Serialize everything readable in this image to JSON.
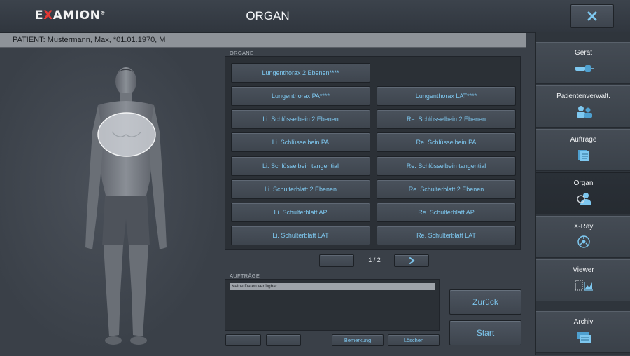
{
  "header": {
    "logo_prefix": "E",
    "logo_x": "X",
    "logo_rest": "AMION",
    "logo_mark": "®",
    "title": "ORGAN"
  },
  "patient": {
    "label": "PATIENT: Mustermann, Max, *01.01.1970, M"
  },
  "sidebar": {
    "items": [
      {
        "label": "Gerät",
        "icon": "device-icon"
      },
      {
        "label": "Patientenverwalt.",
        "icon": "patients-icon"
      },
      {
        "label": "Aufträge",
        "icon": "orders-icon"
      },
      {
        "label": "Organ",
        "icon": "organ-icon",
        "active": true
      },
      {
        "label": "X-Ray",
        "icon": "xray-icon"
      },
      {
        "label": "Viewer",
        "icon": "viewer-icon"
      },
      {
        "label": "Archiv",
        "icon": "archive-icon"
      }
    ]
  },
  "organs": {
    "section_label": "ORGANE",
    "buttons": [
      "Lungenthorax 2 Ebenen****",
      "Lungenthorax PA****",
      "Lungenthorax LAT****",
      "Li. Schlüsselbein 2 Ebenen",
      "Re. Schlüsselbein 2 Ebenen",
      "Li. Schlüsselbein PA",
      "Re. Schlüsselbein PA",
      "Li. Schlüsselbein tangential",
      "Re. Schlüsselbein tangential",
      "Li. Schulterblatt 2 Ebenen",
      "Re. Schulterblatt 2 Ebenen",
      "Li. Schulterblatt AP",
      "Re. Schulterblatt AP",
      "Li. Schulterblatt LAT",
      "Re. Schulterblatt LAT"
    ],
    "page_indicator": "1 / 2"
  },
  "orders": {
    "section_label": "AUFTRÄGE",
    "empty_text": "Keine Daten verfügbar",
    "remark_label": "Bemerkung",
    "delete_label": "Löschen"
  },
  "actions": {
    "back_label": "Zurück",
    "start_label": "Start"
  },
  "colors": {
    "accent_text": "#7ec8f0",
    "logo_red": "#e53935"
  }
}
